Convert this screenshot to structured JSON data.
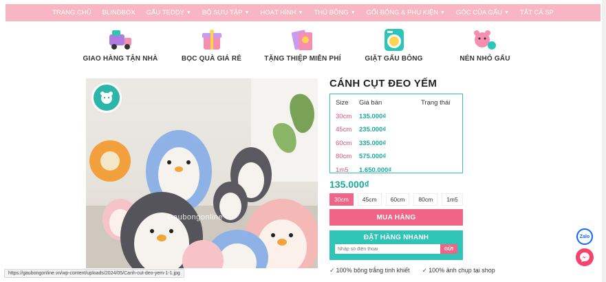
{
  "nav": {
    "items": [
      {
        "label": "TRANG CHỦ",
        "has_dropdown": false
      },
      {
        "label": "BLINDBOX",
        "has_dropdown": false
      },
      {
        "label": "GẤU TEDDY",
        "has_dropdown": true
      },
      {
        "label": "BỘ SƯU TẬP",
        "has_dropdown": true
      },
      {
        "label": "HOẠT HÌNH",
        "has_dropdown": true
      },
      {
        "label": "THÚ BÔNG",
        "has_dropdown": true
      },
      {
        "label": "GỐI BÔNG & PHỤ KIỆN",
        "has_dropdown": true
      },
      {
        "label": "GÓC CỦA GẤU",
        "has_dropdown": true
      },
      {
        "label": "TẤT CẢ SP",
        "has_dropdown": false
      }
    ]
  },
  "features": [
    {
      "icon": "delivery-truck-icon",
      "label": "GIAO HÀNG TẬN NHÀ"
    },
    {
      "icon": "gift-wrap-icon",
      "label": "BỌC QUÀ GIÁ RẺ"
    },
    {
      "icon": "greeting-card-icon",
      "label": "TẶNG THIỆP MIỄN PHÍ"
    },
    {
      "icon": "washing-machine-icon",
      "label": "GIẶT GẤU BÔNG"
    },
    {
      "icon": "shrink-bear-icon",
      "label": "NÉN NHỎ GẤU"
    }
  ],
  "product": {
    "image_watermark": "Gaubongonline",
    "title": "CÁNH CỤT ĐEO YẾM",
    "table": {
      "headers": [
        "Size",
        "Giá bán",
        "Trạng thái"
      ],
      "rows": [
        {
          "size": "30cm",
          "price": "135.000₫"
        },
        {
          "size": "45cm",
          "price": "235.000₫"
        },
        {
          "size": "60cm",
          "price": "335.000₫"
        },
        {
          "size": "80cm",
          "price": "575.000₫"
        },
        {
          "size": "1m5",
          "price": "1.650.000₫"
        }
      ]
    },
    "current_price": "135.000₫",
    "size_options": [
      "30cm",
      "45cm",
      "60cm",
      "80cm",
      "1m5"
    ],
    "selected_size": "30cm",
    "buy_label": "MUA HÀNG",
    "quick_order": {
      "title": "ĐẶT HÀNG NHANH",
      "placeholder": "Nhập số điện thoại",
      "send_label": "GỬI"
    },
    "assurances": [
      "100% bông trắng tinh khiết",
      "100% ảnh chụp tại shop"
    ]
  },
  "status_url": "https://gaubongonline.vn/wp-content/uploads/2024/05/Canh-cut-deo-yem-1-1.jpg",
  "chat": {
    "zalo_label": "Zalo"
  },
  "colors": {
    "nav_bg": "#f7b6c2",
    "accent_pink": "#f06487",
    "accent_teal": "#2ec4b6",
    "price_teal": "#1ba89c",
    "size_pink": "#e84f7a"
  }
}
